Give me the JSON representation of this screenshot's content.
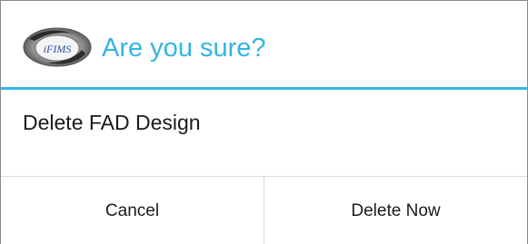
{
  "dialog": {
    "title": "Are you sure?",
    "logo_icon": "ifims-logo-icon",
    "logo_text": "iFIMS",
    "message": "Delete FAD Design",
    "buttons": {
      "cancel_label": "Cancel",
      "confirm_label": "Delete Now"
    }
  },
  "colors": {
    "accent": "#33b5e5",
    "divider": "#dddddd",
    "text": "#1a1a1a",
    "background": "#ffffff"
  }
}
